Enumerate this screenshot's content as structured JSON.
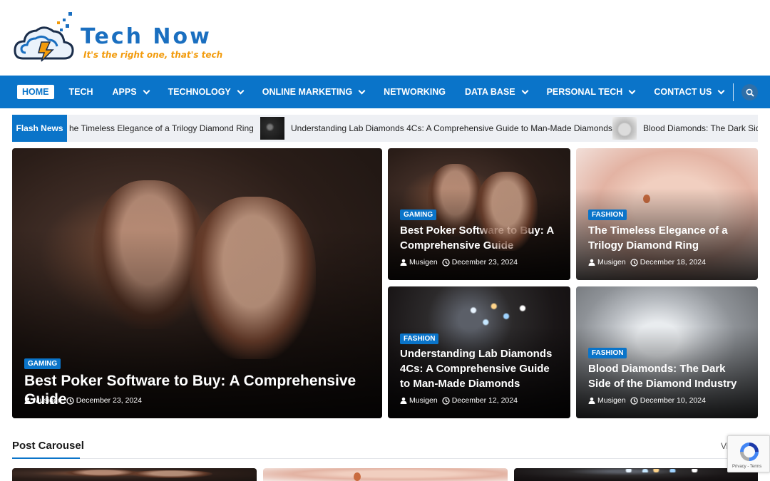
{
  "site": {
    "title": "Tech Now",
    "tagline": "It's the right one, that's tech"
  },
  "nav": {
    "items": [
      {
        "label": "HOME",
        "active": true,
        "dropdown": false
      },
      {
        "label": "TECH",
        "active": false,
        "dropdown": false
      },
      {
        "label": "APPS",
        "active": false,
        "dropdown": true
      },
      {
        "label": "TECHNOLOGY",
        "active": false,
        "dropdown": true
      },
      {
        "label": "ONLINE MARKETING",
        "active": false,
        "dropdown": true
      },
      {
        "label": "NETWORKING",
        "active": false,
        "dropdown": false
      },
      {
        "label": "DATA BASE",
        "active": false,
        "dropdown": true
      },
      {
        "label": "PERSONAL TECH",
        "active": false,
        "dropdown": true
      },
      {
        "label": "CONTACT US",
        "active": false,
        "dropdown": true
      }
    ],
    "search_icon": "search-icon"
  },
  "flash_news": {
    "label": "Flash News",
    "items": [
      {
        "text": "he Timeless Elegance of a Trilogy Diamond Ring"
      },
      {
        "text": "Understanding Lab Diamonds 4Cs: A Comprehensive Guide to Man-Made Diamonds"
      },
      {
        "text": "Blood Diamonds: The Dark Side"
      }
    ]
  },
  "featured": {
    "main": {
      "category": "GAMING",
      "title": "Best Poker Software to Buy: A Comprehensive Guide",
      "author": "Musigen",
      "date": "December 23, 2024"
    },
    "grid": [
      {
        "category": "GAMING",
        "title": "Best Poker Software to Buy: A Comprehensive Guide",
        "author": "Musigen",
        "date": "December 23, 2024"
      },
      {
        "category": "FASHION",
        "title": "The Timeless Elegance of a Trilogy Diamond Ring",
        "author": "Musigen",
        "date": "December 18, 2024"
      },
      {
        "category": "FASHION",
        "title": "Understanding Lab Diamonds 4Cs: A Comprehensive Guide to Man-Made Diamonds",
        "author": "Musigen",
        "date": "December 12, 2024"
      },
      {
        "category": "FASHION",
        "title": "Blood Diamonds: The Dark Side of the Diamond Industry",
        "author": "Musigen",
        "date": "December 10, 2024"
      }
    ]
  },
  "post_carousel": {
    "title": "Post Carousel",
    "view_all": "Vi"
  },
  "recaptcha": {
    "text": "Privacy - Terms"
  },
  "colors": {
    "primary": "#0a74c9",
    "accent": "#f29b0c"
  }
}
